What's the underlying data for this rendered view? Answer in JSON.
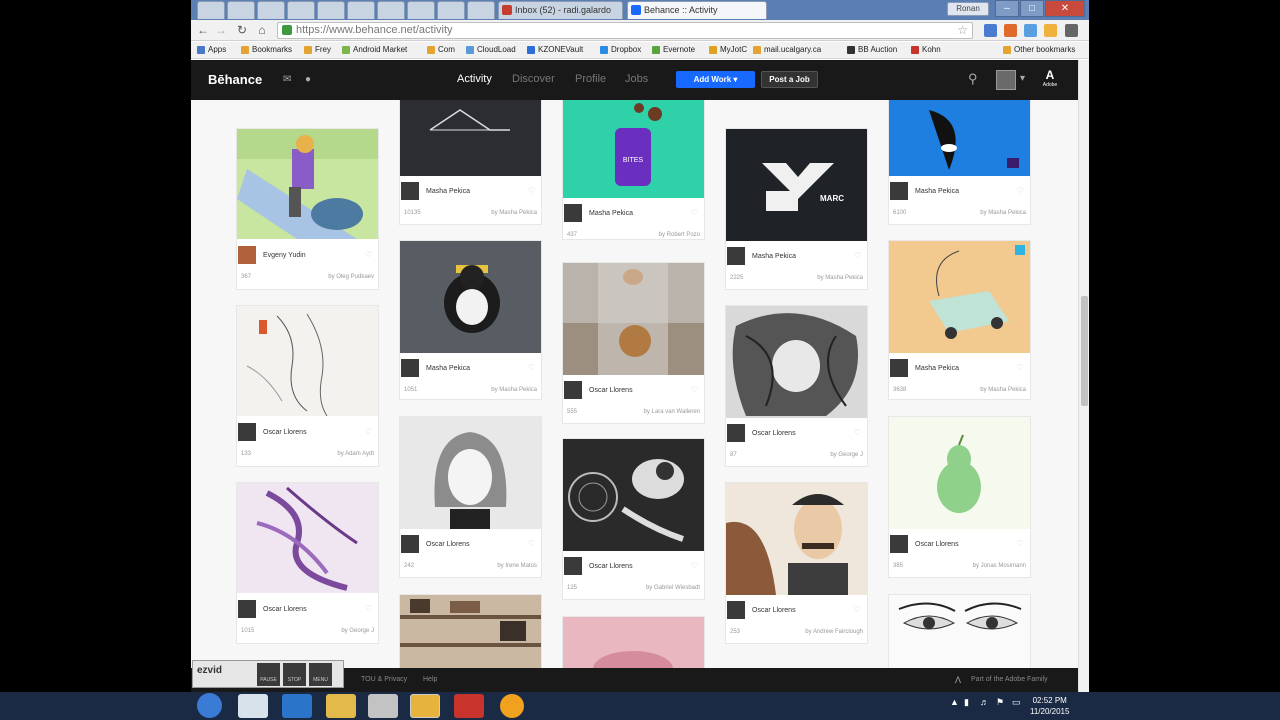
{
  "browser": {
    "tabs": [
      {
        "label": "Inbox (52) - radi.galardo",
        "color": "#c63d2f"
      },
      {
        "label": "Behance :: Activity",
        "color": "#1769ff"
      }
    ],
    "user_badge": "Ronan",
    "url": "https://www.behance.net/activity",
    "bookmarks": [
      "Apps",
      "Bookmarks",
      "Frey",
      "Android Market",
      "Com",
      "CloudLoad",
      "KZONEVault",
      "Dropbox",
      "Evernote",
      "MyJotC",
      "mail.ucalgary.ca",
      "BB Auction",
      "Kohn",
      "Other bookmarks"
    ]
  },
  "behance": {
    "logo": "Bēhance",
    "nav": [
      "Activity",
      "Discover",
      "Profile",
      "Jobs"
    ],
    "add_work": "Add Work ▾",
    "post_job": "Post a Job",
    "adobe": "Adobe"
  },
  "columns": [
    [
      {
        "name": "Evgeny Yudin",
        "likes": "367",
        "by": "by  Oleg Pudkaev",
        "art": "skate"
      },
      {
        "name": "Oscar Llorens",
        "likes": "133",
        "by": "by  Adam Aydt",
        "art": "sketch"
      },
      {
        "name": "Oscar Llorens",
        "likes": "1015",
        "by": "by  George J",
        "art": "purple"
      }
    ],
    [
      {
        "name": "Masha Pekica",
        "likes": "10135",
        "by": "by  Masha Pekica",
        "art": "yoga"
      },
      {
        "name": "Masha Pekica",
        "likes": "1051",
        "by": "by  Masha Pekica",
        "art": "panda"
      },
      {
        "name": "Oscar Llorens",
        "likes": "242",
        "by": "by  Irene Matos",
        "art": "girl"
      },
      {
        "name": "",
        "likes": "",
        "by": "",
        "art": "shelves"
      }
    ],
    [
      {
        "name": "Masha Pekica",
        "likes": "437",
        "by": "by  Robert Pozo",
        "art": "bites"
      },
      {
        "name": "Oscar Llorens",
        "likes": "555",
        "by": "by  Lara van Walleren",
        "art": "jar"
      },
      {
        "name": "Oscar Llorens",
        "likes": "125",
        "by": "by  Gabriel Wiesbadt",
        "art": "astronaut"
      },
      {
        "name": "",
        "likes": "",
        "by": "",
        "art": "pink"
      }
    ],
    [
      {
        "name": "Masha Pekica",
        "likes": "2225",
        "by": "by  Masha Pekica",
        "art": "logo"
      },
      {
        "name": "Oscar Llorens",
        "likes": "87",
        "by": "by  George J",
        "art": "hair"
      },
      {
        "name": "Oscar Llorens",
        "likes": "253",
        "by": "by  Andrew Fairclough",
        "art": "man"
      }
    ],
    [
      {
        "name": "Masha Pekica",
        "likes": "6100",
        "by": "by  Masha Pekica",
        "art": "orca"
      },
      {
        "name": "Masha Pekica",
        "likes": "3638",
        "by": "by  Masha Pekica",
        "art": "car"
      },
      {
        "name": "Oscar Llorens",
        "likes": "385",
        "by": "by  Jonas Mosimann",
        "art": "pear"
      },
      {
        "name": "",
        "likes": "",
        "by": "",
        "art": "eyes"
      }
    ]
  ],
  "footer": {
    "tou": "TOU & Privacy",
    "help": "Help",
    "adobe_family": "Part of the Adobe Family"
  },
  "overlay": {
    "logo": "ezvid",
    "buttons": [
      "PAUSE",
      "STOP",
      "MENU"
    ]
  },
  "taskbar": {
    "time": "02:52 PM",
    "date": "11/20/2015"
  }
}
